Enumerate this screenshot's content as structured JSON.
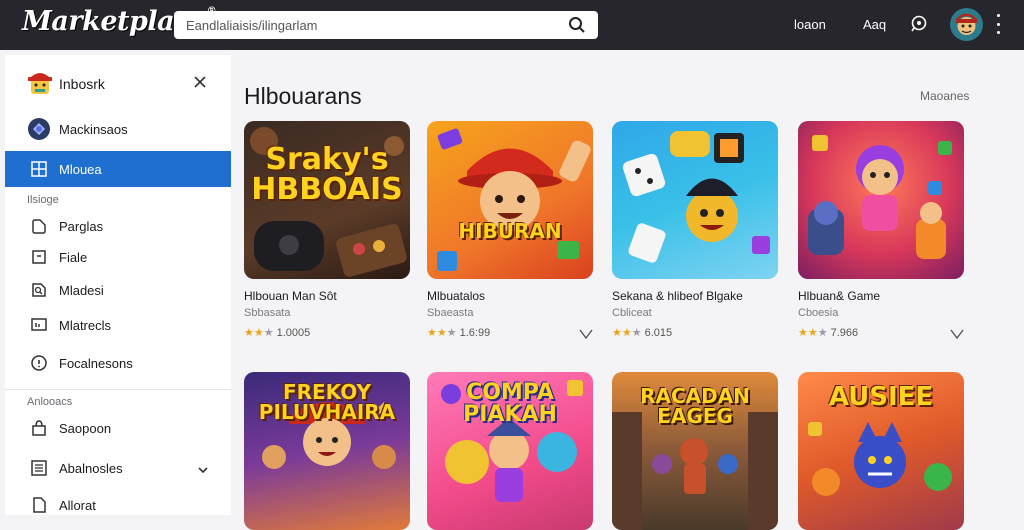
{
  "topbar": {
    "logo": "Marketplace",
    "search_placeholder": "Eandlaliaisis/ilingarlam",
    "link1": "loaon",
    "link2": "Aaq"
  },
  "sidebar": {
    "title": "Inbosrk",
    "items": [
      {
        "label": "Mackinsaos",
        "icon": "globe-icon"
      },
      {
        "label": "Mlouea",
        "icon": "grid-icon",
        "active": true
      }
    ],
    "section1": "Ilsioge",
    "group1": [
      {
        "label": "Parglas",
        "icon": "tag-icon"
      },
      {
        "label": "Fiale",
        "icon": "file-icon"
      },
      {
        "label": "Mladesi",
        "icon": "search-doc-icon"
      },
      {
        "label": "Mlatrecls",
        "icon": "monitor-icon"
      },
      {
        "label": "Focalnesons",
        "icon": "info-icon"
      }
    ],
    "section2": "Anlooacs",
    "group2": [
      {
        "label": "Saopoon",
        "icon": "bag-icon"
      },
      {
        "label": "Abalnosles",
        "icon": "list-icon"
      },
      {
        "label": "Allorat",
        "icon": "doc-icon"
      }
    ]
  },
  "main": {
    "title": "Hlbouarans",
    "more": "Maoanes",
    "cards": [
      {
        "title_art": "Sraky's HBBOAIS",
        "name": "Hlbouan Man Sôt",
        "category": "Sbbasata",
        "rating": "1.0005"
      },
      {
        "title_art": "HIBURAN",
        "name": "Mlbuatalos",
        "category": "Sbaeasta",
        "rating": "1.6:99"
      },
      {
        "title_art": "",
        "name": "Sekana & hlibeof Blgake",
        "category": "Cbliceat",
        "rating": "6.015"
      },
      {
        "title_art": "",
        "name": "Hlbuan& Game",
        "category": "Cboesia",
        "rating": "7.966"
      },
      {
        "title_art": "FREKOY PILUVHAIRA",
        "name": "",
        "category": "",
        "rating": ""
      },
      {
        "title_art": "COMPA PIAKAH",
        "name": "",
        "category": "",
        "rating": ""
      },
      {
        "title_art": "RACADAN EAGEG",
        "name": "",
        "category": "",
        "rating": ""
      },
      {
        "title_art": "AUSIEE",
        "name": "",
        "category": "",
        "rating": ""
      }
    ]
  }
}
